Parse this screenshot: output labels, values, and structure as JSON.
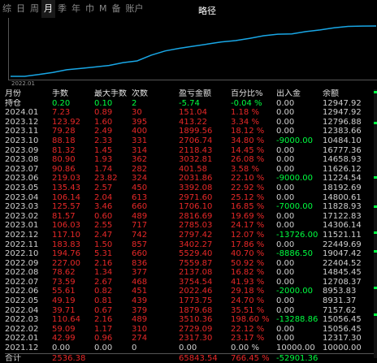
{
  "tabs": [
    "综",
    "日",
    "周",
    "月",
    "季",
    "年",
    "巾",
    "M",
    "备",
    "账户"
  ],
  "active_tab": "月",
  "mode_label": "略径",
  "chart_start_label": "2022.01",
  "chart_line_color": "#19a7e6",
  "headers": [
    "月份",
    "手数",
    "最大手数",
    "次数",
    "盈亏金额",
    "百分比%",
    "出入金",
    "余额"
  ],
  "rows": [
    {
      "m": "持仓",
      "a": "0.20",
      "b": "0.10",
      "n": "2",
      "pl": "-5.74",
      "pct": "-0.04 %",
      "io": "0.00",
      "bal": "12947.92",
      "style": "pos"
    },
    {
      "m": "2024.01",
      "a": "7.23",
      "b": "0.89",
      "n": "30",
      "pl": "151.04",
      "pct": "1.18 %",
      "io": "0.00",
      "bal": "12947.92",
      "style": "red"
    },
    {
      "m": "2023.12",
      "a": "123.92",
      "b": "1.60",
      "n": "395",
      "pl": "413.22",
      "pct": "3.34 %",
      "io": "0.00",
      "bal": "12796.88",
      "style": "red"
    },
    {
      "m": "2023.11",
      "a": "79.28",
      "b": "2.49",
      "n": "400",
      "pl": "1899.56",
      "pct": "18.12 %",
      "io": "0.00",
      "bal": "12383.66",
      "style": "red"
    },
    {
      "m": "2023.10",
      "a": "88.18",
      "b": "2.33",
      "n": "331",
      "pl": "2706.74",
      "pct": "34.80 %",
      "io": "-9000.00",
      "bal": "10484.10",
      "style": "red"
    },
    {
      "m": "2023.09",
      "a": "81.32",
      "b": "1.45",
      "n": "314",
      "pl": "2118.43",
      "pct": "14.45 %",
      "io": "0.00",
      "bal": "16777.36",
      "style": "red"
    },
    {
      "m": "2023.08",
      "a": "80.90",
      "b": "1.93",
      "n": "362",
      "pl": "3032.81",
      "pct": "26.08 %",
      "io": "0.00",
      "bal": "14658.93",
      "style": "red"
    },
    {
      "m": "2023.07",
      "a": "90.86",
      "b": "1.74",
      "n": "282",
      "pl": "401.58",
      "pct": "3.58 %",
      "io": "0.00",
      "bal": "11626.12",
      "style": "red"
    },
    {
      "m": "2023.06",
      "a": "219.03",
      "b": "23.82",
      "n": "324",
      "pl": "2031.86",
      "pct": "22.10 %",
      "io": "-9000.00",
      "bal": "11224.54",
      "style": "red"
    },
    {
      "m": "2023.05",
      "a": "135.43",
      "b": "2.57",
      "n": "450",
      "pl": "3392.08",
      "pct": "22.92 %",
      "io": "0.00",
      "bal": "18192.69",
      "style": "red"
    },
    {
      "m": "2023.04",
      "a": "106.14",
      "b": "2.04",
      "n": "613",
      "pl": "2971.60",
      "pct": "25.12 %",
      "io": "0.00",
      "bal": "14800.61",
      "style": "red"
    },
    {
      "m": "2023.03",
      "a": "125.57",
      "b": "3.46",
      "n": "660",
      "pl": "1706.10",
      "pct": "16.85 %",
      "io": "-7000.00",
      "bal": "11828.93",
      "style": "red"
    },
    {
      "m": "2023.02",
      "a": "81.57",
      "b": "0.60",
      "n": "489",
      "pl": "2816.69",
      "pct": "19.69 %",
      "io": "0.00",
      "bal": "17122.83",
      "style": "red"
    },
    {
      "m": "2023.01",
      "a": "106.03",
      "b": "2.55",
      "n": "717",
      "pl": "2785.03",
      "pct": "24.17 %",
      "io": "0.00",
      "bal": "14306.14",
      "style": "red"
    },
    {
      "m": "2022.12",
      "a": "117.10",
      "b": "2.47",
      "n": "742",
      "pl": "2797.42",
      "pct": "12.07 %",
      "io": "-13726.00",
      "bal": "11521.11",
      "style": "red"
    },
    {
      "m": "2022.11",
      "a": "183.83",
      "b": "1.50",
      "n": "857",
      "pl": "3402.27",
      "pct": "17.86 %",
      "io": "0.00",
      "bal": "22449.69",
      "style": "red"
    },
    {
      "m": "2022.10",
      "a": "194.76",
      "b": "5.31",
      "n": "660",
      "pl": "5529.40",
      "pct": "40.70 %",
      "io": "-8886.50",
      "bal": "19047.42",
      "style": "red"
    },
    {
      "m": "2022.09",
      "a": "227.00",
      "b": "2.16",
      "n": "836",
      "pl": "7559.87",
      "pct": "50.92 %",
      "io": "0.00",
      "bal": "22404.52",
      "style": "red"
    },
    {
      "m": "2022.08",
      "a": "78.62",
      "b": "1.34",
      "n": "377",
      "pl": "2137.08",
      "pct": "16.82 %",
      "io": "0.00",
      "bal": "14845.45",
      "style": "red"
    },
    {
      "m": "2022.07",
      "a": "73.59",
      "b": "2.67",
      "n": "468",
      "pl": "3754.54",
      "pct": "41.93 %",
      "io": "0.00",
      "bal": "12708.37",
      "style": "red"
    },
    {
      "m": "2022.06",
      "a": "55.61",
      "b": "0.82",
      "n": "451",
      "pl": "2022.46",
      "pct": "29.18 %",
      "io": "-2000.00",
      "bal": "8953.83",
      "style": "red"
    },
    {
      "m": "2022.05",
      "a": "49.19",
      "b": "0.81",
      "n": "439",
      "pl": "1773.75",
      "pct": "24.70 %",
      "io": "0.00",
      "bal": "8931.37",
      "style": "red"
    },
    {
      "m": "2022.04",
      "a": "39.71",
      "b": "0.67",
      "n": "379",
      "pl": "1879.68",
      "pct": "35.51 %",
      "io": "0.00",
      "bal": "7157.62",
      "style": "red"
    },
    {
      "m": "2022.03",
      "a": "110.64",
      "b": "2.16",
      "n": "489",
      "pl": "3510.36",
      "pct": "198.60 %",
      "io": "-13288.86",
      "bal": "15056.45",
      "style": "red"
    },
    {
      "m": "2022.02",
      "a": "59.09",
      "b": "1.17",
      "n": "310",
      "pl": "2729.09",
      "pct": "22.12 %",
      "io": "0.00",
      "bal": "15056.45",
      "style": "red"
    },
    {
      "m": "2022.01",
      "a": "42.99",
      "b": "0.96",
      "n": "274",
      "pl": "2317.30",
      "pct": "23.17 %",
      "io": "0.00",
      "bal": "12317.30",
      "style": "red"
    },
    {
      "m": "2021.12",
      "a": "0.00",
      "b": "0.00",
      "n": "0",
      "pl": "0.00",
      "pct": "0.00 %",
      "io": "10000.00",
      "bal": "10000.00",
      "style": "zero"
    }
  ],
  "total": {
    "m": "合计",
    "a": "2536.38",
    "b": "",
    "n": "",
    "pl": "65843.54",
    "pct": "766.45 %",
    "io": "-52901.36",
    "bal": ""
  }
}
